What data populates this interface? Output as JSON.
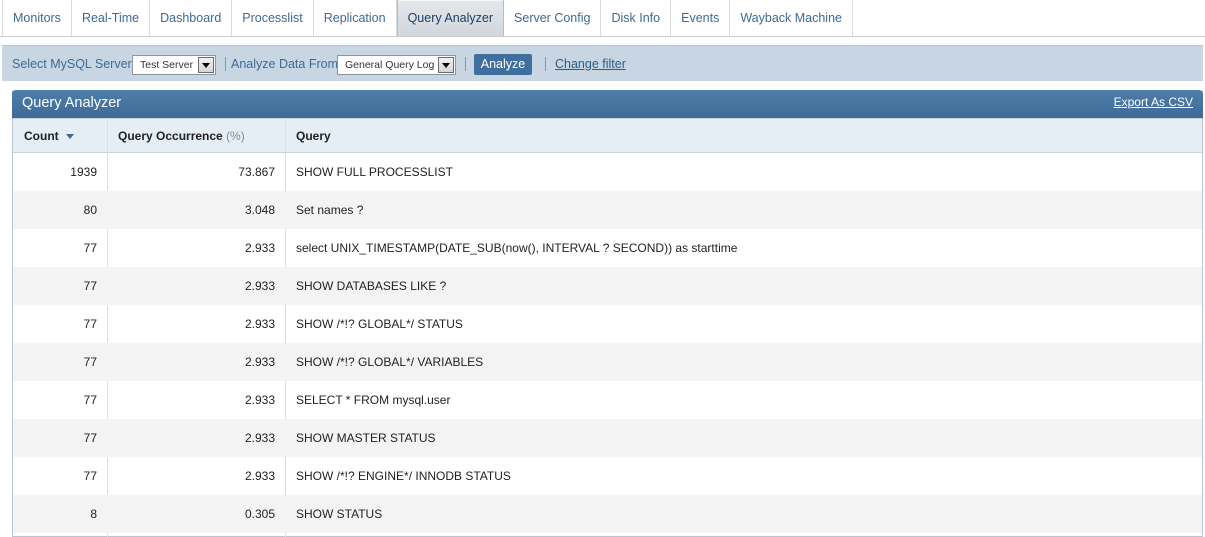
{
  "tabs": [
    {
      "label": "Monitors"
    },
    {
      "label": "Real-Time"
    },
    {
      "label": "Dashboard"
    },
    {
      "label": "Processlist"
    },
    {
      "label": "Replication"
    },
    {
      "label": "Query Analyzer",
      "active": true
    },
    {
      "label": "Server Config"
    },
    {
      "label": "Disk Info"
    },
    {
      "label": "Events"
    },
    {
      "label": "Wayback Machine"
    }
  ],
  "filter": {
    "server_label": "Select MySQL Server",
    "server_value": "Test Server",
    "source_label": "Analyze Data From",
    "source_value": "General Query Log",
    "analyze_button": "Analyze",
    "change_filter": "Change filter"
  },
  "panel": {
    "title": "Query Analyzer",
    "export": "Export As CSV"
  },
  "table": {
    "headers": {
      "count": "Count",
      "occurrence": "Query Occurrence",
      "occurrence_unit": "(%)",
      "query": "Query"
    },
    "rows": [
      {
        "count": "1939",
        "occurrence": "73.867",
        "query": "SHOW FULL PROCESSLIST"
      },
      {
        "count": "80",
        "occurrence": "3.048",
        "query": "Set names ?"
      },
      {
        "count": "77",
        "occurrence": "2.933",
        "query": "select UNIX_TIMESTAMP(DATE_SUB(now(), INTERVAL ? SECOND)) as starttime"
      },
      {
        "count": "77",
        "occurrence": "2.933",
        "query": "SHOW DATABASES LIKE ?"
      },
      {
        "count": "77",
        "occurrence": "2.933",
        "query": "SHOW /*!? GLOBAL*/ STATUS"
      },
      {
        "count": "77",
        "occurrence": "2.933",
        "query": "SHOW /*!? GLOBAL*/ VARIABLES"
      },
      {
        "count": "77",
        "occurrence": "2.933",
        "query": "SELECT * FROM mysql.user"
      },
      {
        "count": "77",
        "occurrence": "2.933",
        "query": "SHOW MASTER STATUS"
      },
      {
        "count": "77",
        "occurrence": "2.933",
        "query": "SHOW /*!? ENGINE*/ INNODB STATUS"
      },
      {
        "count": "8",
        "occurrence": "0.305",
        "query": "SHOW STATUS"
      }
    ]
  },
  "colors": {
    "link": "#3d6a95",
    "header_bar": "#4a78a5",
    "filter_bar": "#c8d6e3",
    "button": "#3f6f9c"
  }
}
